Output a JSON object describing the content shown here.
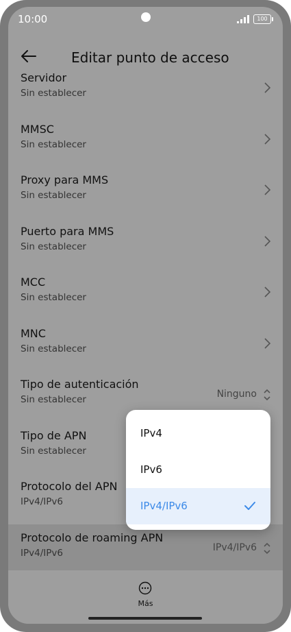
{
  "status_bar": {
    "time": "10:00",
    "battery": "100"
  },
  "header": {
    "title": "Editar punto de acceso"
  },
  "settings": [
    {
      "title": "Servidor",
      "subtitle": "Sin establecer"
    },
    {
      "title": "MMSC",
      "subtitle": "Sin establecer"
    },
    {
      "title": "Proxy para MMS",
      "subtitle": "Sin establecer"
    },
    {
      "title": "Puerto para MMS",
      "subtitle": "Sin establecer"
    },
    {
      "title": "MCC",
      "subtitle": "Sin establecer"
    },
    {
      "title": "MNC",
      "subtitle": "Sin establecer"
    },
    {
      "title": "Tipo de autenticación",
      "subtitle": "Sin establecer",
      "value": "Ninguno"
    },
    {
      "title": "Tipo de APN",
      "subtitle": "Sin establecer"
    },
    {
      "title": "Protocolo del APN",
      "subtitle": "IPv4/IPv6"
    },
    {
      "title": "Protocolo de roaming APN",
      "subtitle": "IPv4/IPv6",
      "value": "IPv4/IPv6"
    }
  ],
  "dropdown": {
    "options": [
      {
        "label": "IPv4"
      },
      {
        "label": "IPv6"
      },
      {
        "label": "IPv4/IPv6"
      }
    ],
    "selected": "IPv4/IPv6"
  },
  "bottom_bar": {
    "more_label": "Más"
  },
  "colors": {
    "accent": "#3c8ae8",
    "overlay": "#9e9e9e",
    "selected_bg": "#e7f0fc"
  }
}
